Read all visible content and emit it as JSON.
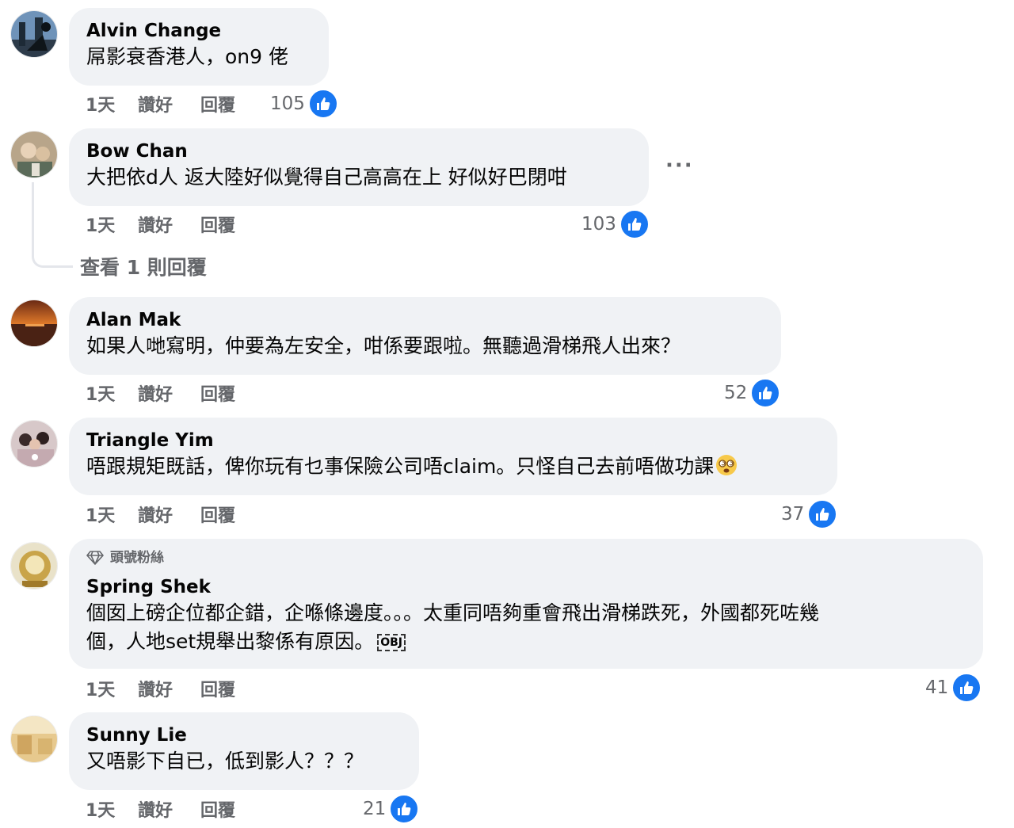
{
  "comments": [
    {
      "author": "Alvin Change",
      "text": "屌影衰香港人，on9 佬",
      "time": "1天",
      "like_label": "讚好",
      "reply_label": "回覆",
      "reactions": "105"
    },
    {
      "author": "Bow Chan",
      "text": "大把依d人 返大陸好似覺得自己高高在上 好似好巴閉咁",
      "time": "1天",
      "like_label": "讚好",
      "reply_label": "回覆",
      "reactions": "103",
      "more": "···",
      "view_replies": "查看 1 則回覆"
    },
    {
      "author": "Alan Mak",
      "text": "如果人哋寫明，仲要為左安全，咁係要跟啦。無聽過滑梯飛人出來？",
      "time": "1天",
      "like_label": "讚好",
      "reply_label": "回覆",
      "reactions": "52"
    },
    {
      "author": "Triangle Yim",
      "text": "唔跟規矩既話，俾你玩有乜事保險公司唔claim。只怪自己去前唔做功課",
      "time": "1天",
      "like_label": "讚好",
      "reply_label": "回覆",
      "reactions": "37"
    },
    {
      "badge": "頭號粉絲",
      "author": "Spring Shek",
      "text_line1": "個囡上磅企位都企錯，企喺條邊度。。。太重同唔夠重會飛出滑梯跌死，外國都死咗幾",
      "text_line2": "個，人地set規舉出黎係有原因。",
      "obj": "OBJ",
      "time": "1天",
      "like_label": "讚好",
      "reply_label": "回覆",
      "reactions": "41"
    },
    {
      "author": "Sunny Lie",
      "text": "又唔影下自已，低到影人？？？",
      "time": "1天",
      "like_label": "讚好",
      "reply_label": "回覆",
      "reactions": "21"
    }
  ],
  "colors": {
    "bubble": "#f0f2f5",
    "meta_text": "#65676b",
    "like_blue": "#1877f2"
  },
  "icons": [
    "like-thumb-icon",
    "diamond-icon",
    "dizzy-face-emoji"
  ]
}
